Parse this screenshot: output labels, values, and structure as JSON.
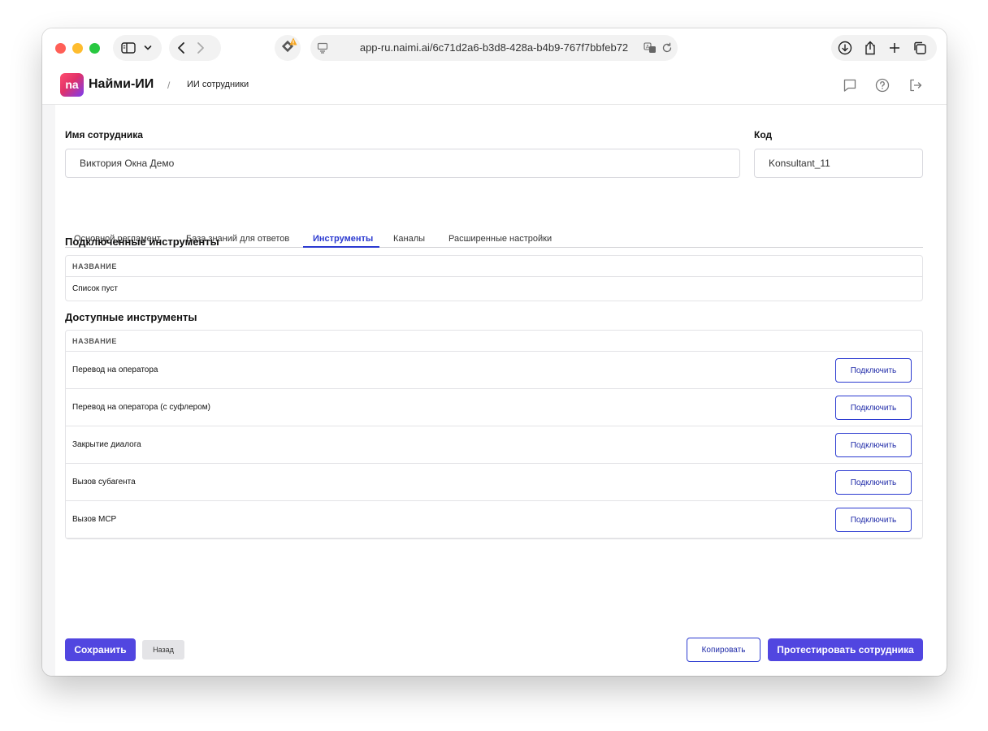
{
  "browser": {
    "url": "app-ru.naimi.ai/6c71d2a6-b3d8-428a-b4b9-767f7bbfeb72"
  },
  "header": {
    "logo_text": "na",
    "brand": "Найми-ИИ",
    "separator": "/",
    "breadcrumb": "ИИ сотрудники"
  },
  "form": {
    "name_label": "Имя сотрудника",
    "name_value": "Виктория Окна Демо",
    "code_label": "Код",
    "code_value": "Konsultant_11"
  },
  "tabs": [
    {
      "label": "Основной регламент",
      "active": false
    },
    {
      "label": "База знаний для ответов",
      "active": false
    },
    {
      "label": "Инструменты",
      "active": true
    },
    {
      "label": "Каналы",
      "active": false
    },
    {
      "label": "Расширенные настройки",
      "active": false
    }
  ],
  "connected": {
    "title": "Подключенные инструменты",
    "column_header": "НАЗВАНИЕ",
    "empty_text": "Список пуст"
  },
  "available": {
    "title": "Доступные инструменты",
    "column_header": "НАЗВАНИЕ",
    "rows": [
      {
        "name": "Перевод на оператора",
        "action": "Подключить"
      },
      {
        "name": "Перевод на оператора (с суфлером)",
        "action": "Подключить"
      },
      {
        "name": "Закрытие диалога",
        "action": "Подключить"
      },
      {
        "name": "Вызов субагента",
        "action": "Подключить"
      },
      {
        "name": "Вызов MCP",
        "action": "Подключить"
      }
    ]
  },
  "footer": {
    "save_label": "Сохранить",
    "back_label": "Назад",
    "copy_label": "Копировать",
    "test_label": "Протестировать сотрудника"
  },
  "colors": {
    "accent": "#5146e0",
    "link": "#2b3ad0"
  }
}
